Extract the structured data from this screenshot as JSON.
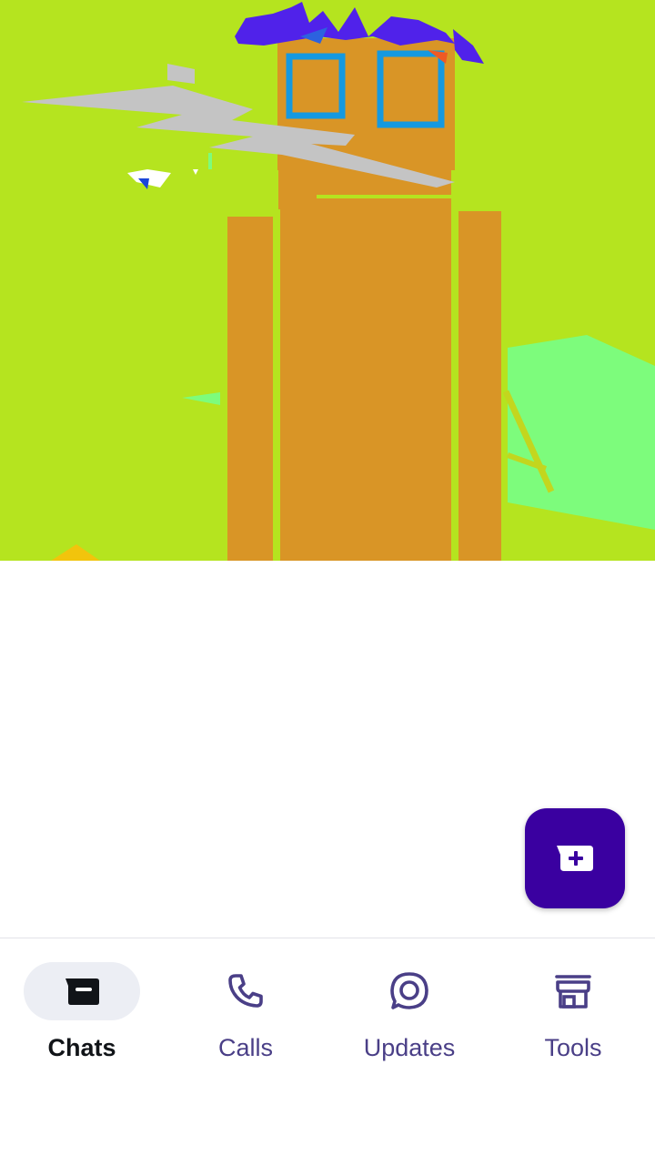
{
  "colors": {
    "illustration_background": "#b5e41f",
    "fab_background": "#3a00a0",
    "nav_active_pill": "#eceef4",
    "nav_active_text": "#111418",
    "nav_inactive": "#4a3f87"
  },
  "fab": {
    "icon": "new-chat-icon"
  },
  "bottom_nav": {
    "items": [
      {
        "label": "Chats",
        "icon": "chats-icon",
        "active": true
      },
      {
        "label": "Calls",
        "icon": "phone-icon",
        "active": false
      },
      {
        "label": "Updates",
        "icon": "updates-icon",
        "active": false
      },
      {
        "label": "Tools",
        "icon": "store-icon",
        "active": false
      }
    ]
  }
}
